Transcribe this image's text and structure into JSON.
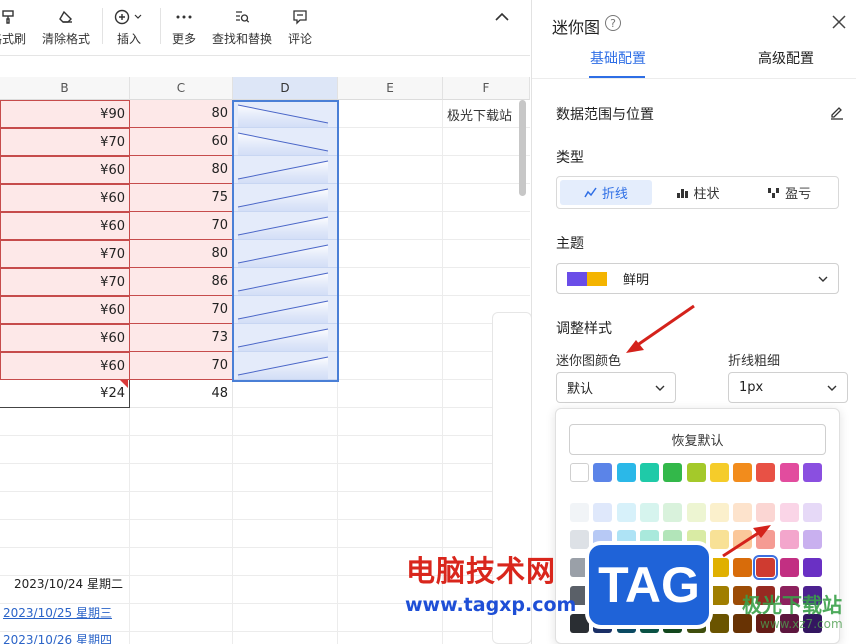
{
  "toolbar": {
    "format_painter": "格式刷",
    "clear_format": "清除格式",
    "insert": "插入",
    "more": "更多",
    "find_replace": "查找和替换",
    "comment": "评论"
  },
  "grid": {
    "columns": [
      "B",
      "C",
      "D",
      "E",
      "F"
    ],
    "b_values": [
      "¥90",
      "¥70",
      "¥60",
      "¥60",
      "¥60",
      "¥70",
      "¥70",
      "¥60",
      "¥60",
      "¥60"
    ],
    "c_values": [
      "80",
      "60",
      "80",
      "75",
      "70",
      "80",
      "86",
      "70",
      "73",
      "70"
    ],
    "b_total": "¥24",
    "c_total": "48",
    "f1_text": "极光下载站",
    "dates": [
      "2023/10/24 星期二",
      "2023/10/25 星期三",
      "2023/10/26 星期四"
    ],
    "sparkline_rows": [
      [
        90,
        80
      ],
      [
        70,
        60
      ],
      [
        60,
        80
      ],
      [
        60,
        75
      ],
      [
        60,
        70
      ],
      [
        70,
        80
      ],
      [
        70,
        86
      ],
      [
        60,
        70
      ],
      [
        60,
        73
      ],
      [
        60,
        70
      ]
    ]
  },
  "panel": {
    "title": "迷你图",
    "help_glyph": "?",
    "tab_basic": "基础配置",
    "tab_advanced": "高级配置",
    "data_range_label": "数据范围与位置",
    "type_label": "类型",
    "type_line": "折线",
    "type_column": "柱状",
    "type_winloss": "盈亏",
    "theme_label": "主题",
    "theme_value": "鲜明",
    "theme_colors": [
      "#6a4de8",
      "#f4b400"
    ],
    "style_label": "调整样式",
    "color_label": "迷你图颜色",
    "color_value": "默认",
    "weight_label": "折线粗细",
    "weight_value": "1px",
    "reset_label": "恢复默认",
    "accent": "#2e6ee5"
  },
  "palette": {
    "row1": [
      "#ffffff",
      "#5b84e8",
      "#2bb8e8",
      "#1fcaa8",
      "#33b84a",
      "#a4c92a",
      "#f5cc2a",
      "#f28c1c",
      "#e85145",
      "#e24c9e",
      "#8a4fe0"
    ],
    "row2": [
      "#f1f4f7",
      "#dfe8fb",
      "#d7f1fa",
      "#d6f4ee",
      "#d9f2dc",
      "#edf5d2",
      "#fbf0cc",
      "#fde3cc",
      "#fbd6d3",
      "#fad5e7",
      "#e6d9f7"
    ],
    "row3": [
      "#dde1e6",
      "#b7c9f5",
      "#aee3f5",
      "#a9e9dc",
      "#b2e5b9",
      "#d9eba4",
      "#f8e196",
      "#fbc79a",
      "#f59b93",
      "#f3a6cc",
      "#c9b0ef"
    ],
    "row4": [
      "#9aa0a8",
      "#3e66cc",
      "#1898c4",
      "#15a88c",
      "#26933b",
      "#87a61e",
      "#e0b000",
      "#d86c0a",
      "#cf3b30",
      "#c22f82",
      "#6a30c4"
    ],
    "row5": [
      "#5a6068",
      "#2a4aa0",
      "#116f92",
      "#0f7c66",
      "#1b6b2b",
      "#5f7514",
      "#a07e00",
      "#9c4c06",
      "#962a22",
      "#8c215d",
      "#4c2190"
    ],
    "row6": [
      "#2a2e33",
      "#1a2f66",
      "#0b4a62",
      "#0a5244",
      "#12471d",
      "#3f4e0d",
      "#6a5400",
      "#683304",
      "#641c17",
      "#5d163e",
      "#331660"
    ],
    "selected_row": 3,
    "selected_col": 8
  },
  "watermark": {
    "cn": "电脑技术网",
    "url": "www.tagxp.com",
    "tag": "TAG",
    "jg": "极光下载站",
    "xz": "www.xz7.com"
  }
}
